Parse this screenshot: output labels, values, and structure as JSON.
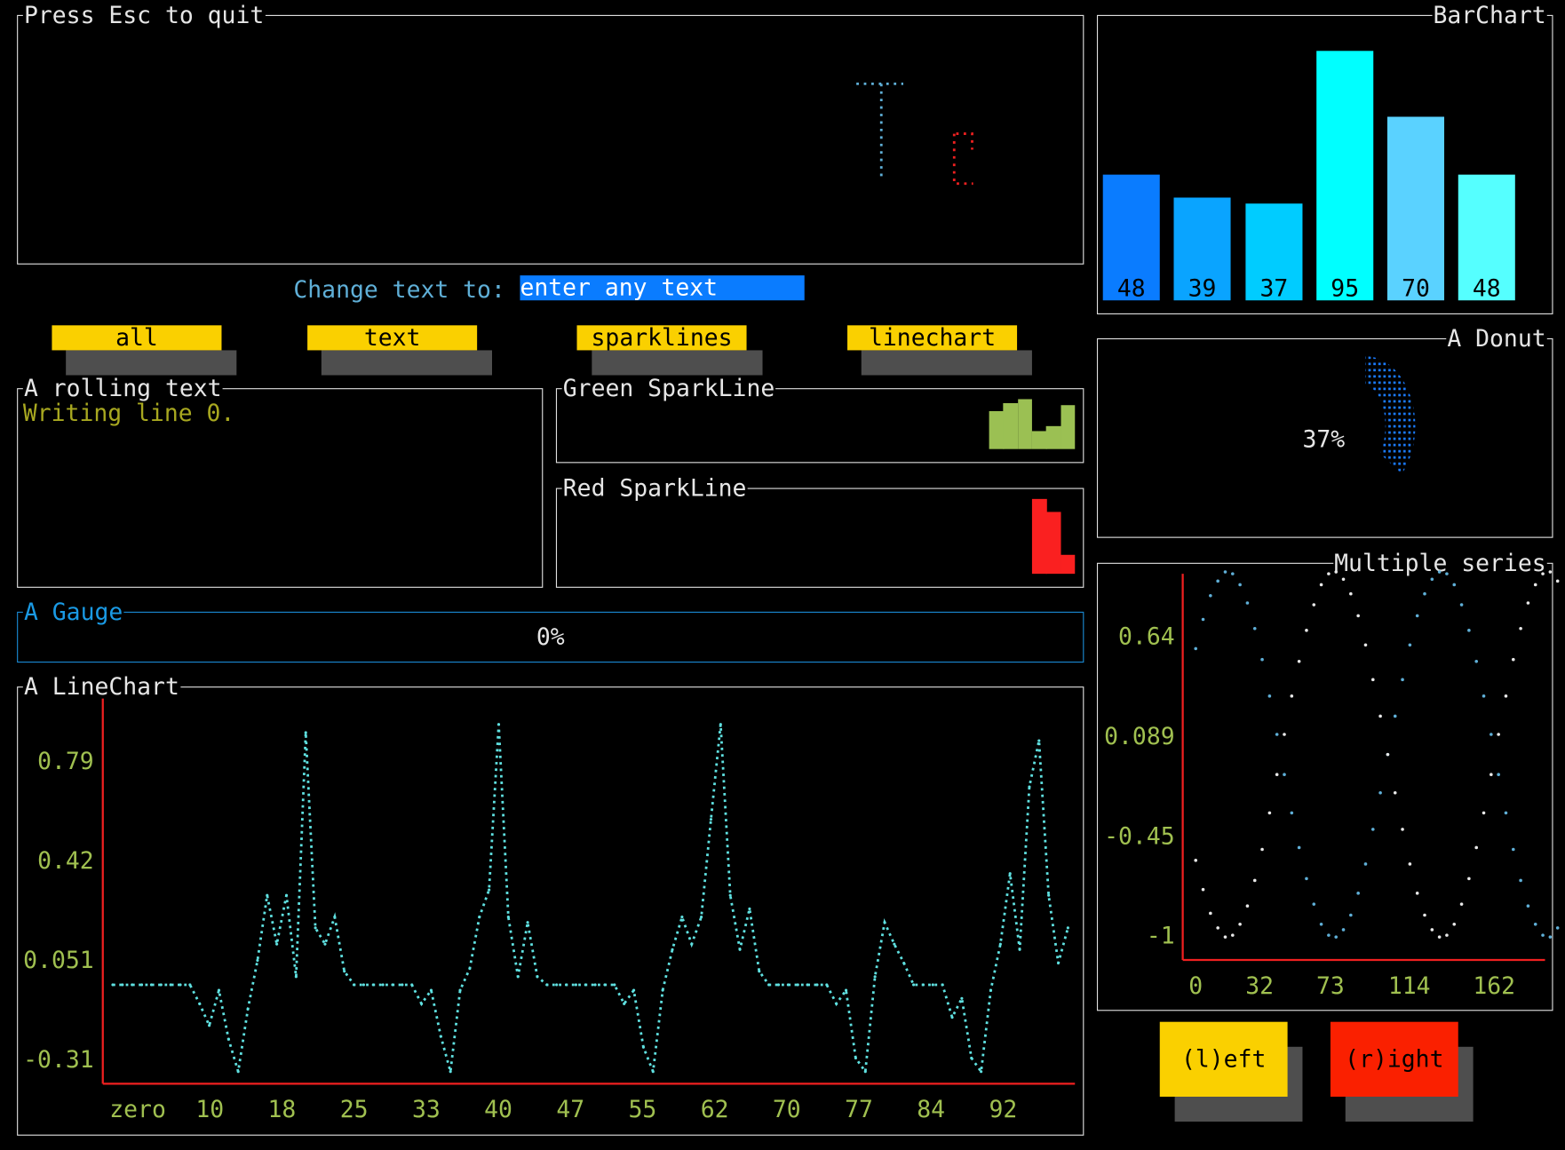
{
  "canvas": {
    "title": "Press Esc to quit"
  },
  "prompt": {
    "label": "Change text to: ",
    "input_value": "enter any text"
  },
  "buttons": [
    {
      "label": "all"
    },
    {
      "label": "text"
    },
    {
      "label": "sparklines"
    },
    {
      "label": "linechart"
    }
  ],
  "rolling": {
    "title": "A rolling text",
    "content": "Writing line 0."
  },
  "green_sparkline": {
    "title": "Green SparkLine",
    "color": "#9bc053",
    "values": [
      37,
      45,
      49,
      18,
      23,
      43
    ]
  },
  "red_sparkline": {
    "title": "Red SparkLine",
    "color": "#fa2020",
    "values": [
      75,
      62,
      19
    ]
  },
  "gauge": {
    "title": "A Gauge",
    "label": "0%",
    "percent": 0,
    "color": "#1a8ad4"
  },
  "barchart": {
    "title": "BarChart",
    "bars": [
      {
        "label": "48",
        "value": 48,
        "color": "#0a7cff"
      },
      {
        "label": "39",
        "value": 39,
        "color": "#0aa4ff"
      },
      {
        "label": "37",
        "value": 37,
        "color": "#00ccff"
      },
      {
        "label": "95",
        "value": 95,
        "color": "#00ffff"
      },
      {
        "label": "70",
        "value": 70,
        "color": "#5ad2ff"
      },
      {
        "label": "48",
        "value": 48,
        "color": "#55ffff"
      }
    ]
  },
  "donut": {
    "title": "A Donut",
    "label": "37%",
    "percent": 37,
    "color": "#1a7cff"
  },
  "nav": {
    "left": "(l)eft",
    "right": "(r)ight"
  },
  "chart_data": [
    {
      "type": "line",
      "title": "A LineChart",
      "color": "#5fe0e0",
      "x_tick_labels": [
        "zero",
        "10",
        "18",
        "25",
        "33",
        "40",
        "47",
        "55",
        "62",
        "70",
        "77",
        "84",
        "92"
      ],
      "y_tick_labels": [
        "0.79",
        "0.42",
        "0.051",
        "-0.31"
      ],
      "ylim": [
        -0.31,
        0.79
      ],
      "xlim": [
        0,
        99
      ],
      "values": [
        -0.03,
        -0.03,
        -0.03,
        -0.03,
        -0.03,
        -0.03,
        -0.03,
        -0.03,
        -0.03,
        -0.1,
        -0.18,
        -0.05,
        -0.23,
        -0.35,
        -0.12,
        0.06,
        0.3,
        0.12,
        0.3,
        0.0,
        0.9,
        0.18,
        0.12,
        0.22,
        0.02,
        -0.03,
        -0.03,
        -0.03,
        -0.03,
        -0.03,
        -0.03,
        -0.03,
        -0.1,
        -0.05,
        -0.22,
        -0.35,
        -0.05,
        0.03,
        0.22,
        0.32,
        0.93,
        0.22,
        0.0,
        0.2,
        0.0,
        -0.03,
        -0.03,
        -0.03,
        -0.03,
        -0.03,
        -0.03,
        -0.03,
        -0.03,
        -0.1,
        -0.05,
        -0.26,
        -0.35,
        -0.05,
        0.1,
        0.22,
        0.12,
        0.22,
        0.58,
        0.93,
        0.3,
        0.1,
        0.25,
        0.02,
        -0.03,
        -0.03,
        -0.03,
        -0.03,
        -0.03,
        -0.03,
        -0.03,
        -0.1,
        -0.05,
        -0.3,
        -0.35,
        0.0,
        0.2,
        0.12,
        0.05,
        -0.03,
        -0.03,
        -0.03,
        -0.03,
        -0.15,
        -0.08,
        -0.3,
        -0.35,
        -0.05,
        0.12,
        0.38,
        0.1,
        0.7,
        0.87,
        0.3,
        0.05,
        0.18
      ]
    },
    {
      "type": "scatter",
      "title": "Multiple series",
      "x_tick_labels": [
        "0",
        "32",
        "73",
        "114",
        "162"
      ],
      "y_tick_labels": [
        "0.64",
        "0.089",
        "-0.45",
        "-1"
      ],
      "xlim": [
        0,
        196
      ],
      "ylim": [
        -1,
        0.64
      ],
      "series": [
        {
          "color": "#5fafd7",
          "x_step": 4,
          "values": [
            0.58,
            0.74,
            0.87,
            0.95,
            1.0,
            0.99,
            0.93,
            0.83,
            0.69,
            0.52,
            0.32,
            0.11,
            -0.11,
            -0.32,
            -0.51,
            -0.68,
            -0.82,
            -0.93,
            -0.99,
            -1.0,
            -0.96,
            -0.88,
            -0.76,
            -0.6,
            -0.41,
            -0.21,
            0.0,
            0.21,
            0.41,
            0.6,
            0.76,
            0.88,
            0.96,
            1.0,
            0.99,
            0.93,
            0.82,
            0.68,
            0.51,
            0.32,
            0.11,
            -0.11,
            -0.32,
            -0.52,
            -0.69,
            -0.83,
            -0.93,
            -0.99,
            -1.0,
            -0.95
          ]
        },
        {
          "color": "#e8e8e8",
          "x_step": 4,
          "values": [
            -0.58,
            -0.74,
            -0.87,
            -0.95,
            -1.0,
            -0.99,
            -0.93,
            -0.83,
            -0.69,
            -0.52,
            -0.32,
            -0.11,
            0.11,
            0.32,
            0.51,
            0.68,
            0.82,
            0.93,
            0.99,
            1.0,
            0.96,
            0.88,
            0.76,
            0.6,
            0.41,
            0.21,
            0.0,
            -0.21,
            -0.41,
            -0.6,
            -0.76,
            -0.88,
            -0.96,
            -1.0,
            -0.99,
            -0.93,
            -0.82,
            -0.68,
            -0.51,
            -0.32,
            -0.11,
            0.11,
            0.32,
            0.52,
            0.69,
            0.83,
            0.93,
            0.99,
            1.0,
            0.95
          ]
        }
      ]
    }
  ]
}
